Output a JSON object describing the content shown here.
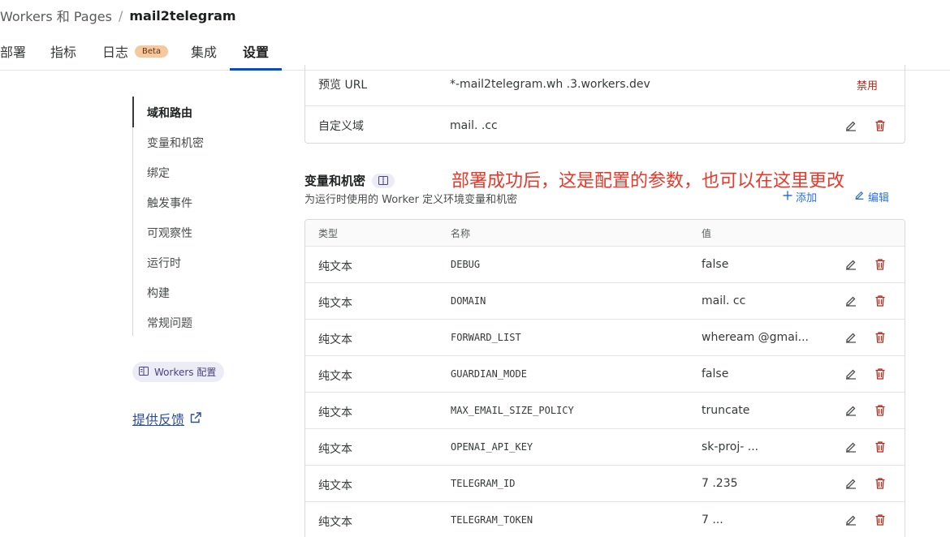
{
  "breadcrumb": {
    "parent": "Workers 和 Pages",
    "separator": "/",
    "current": "mail2telegram"
  },
  "tabs": [
    {
      "label": "部署"
    },
    {
      "label": "指标"
    },
    {
      "label": "日志",
      "badge": "Beta"
    },
    {
      "label": "集成"
    },
    {
      "label": "设置",
      "active": true
    }
  ],
  "sidebar": {
    "items": [
      {
        "label": "域和路由",
        "active": true
      },
      {
        "label": "变量和机密"
      },
      {
        "label": "绑定"
      },
      {
        "label": "触发事件"
      },
      {
        "label": "可观察性"
      },
      {
        "label": "运行时"
      },
      {
        "label": "构建"
      },
      {
        "label": "常规问题"
      }
    ],
    "workers_config": "Workers 配置",
    "feedback": "提供反馈"
  },
  "domains": {
    "rows": [
      {
        "label": "预览 URL",
        "value": "*-mail2telegram.wh   .3.workers.dev",
        "action": "禁用"
      },
      {
        "label": "自定义域",
        "value": "mail.      .cc"
      }
    ]
  },
  "variables": {
    "title": "变量和机密",
    "description": "为运行时使用的 Worker 定义环境变量和机密",
    "annotation": "部署成功后，这是配置的参数，也可以在这里更改",
    "add_label": "添加",
    "edit_label": "编辑",
    "columns": {
      "type": "类型",
      "name": "名称",
      "value": "值"
    },
    "rows": [
      {
        "type": "纯文本",
        "name": "DEBUG",
        "value": "false"
      },
      {
        "type": "纯文本",
        "name": "DOMAIN",
        "value": "mail.     cc"
      },
      {
        "type": "纯文本",
        "name": "FORWARD_LIST",
        "value": "wheream  @gmai..."
      },
      {
        "type": "纯文本",
        "name": "GUARDIAN_MODE",
        "value": "false"
      },
      {
        "type": "纯文本",
        "name": "MAX_EMAIL_SIZE_POLICY",
        "value": "truncate"
      },
      {
        "type": "纯文本",
        "name": "OPENAI_API_KEY",
        "value": "sk-proj-   ..."
      },
      {
        "type": "纯文本",
        "name": "TELEGRAM_ID",
        "value": "7    .235"
      },
      {
        "type": "纯文本",
        "name": "TELEGRAM_TOKEN",
        "value": "7     ..."
      }
    ]
  },
  "colors": {
    "accent": "#0051c3",
    "danger": "#b52a1b",
    "annotation": "#e8382a",
    "link": "#2a6fe0"
  }
}
